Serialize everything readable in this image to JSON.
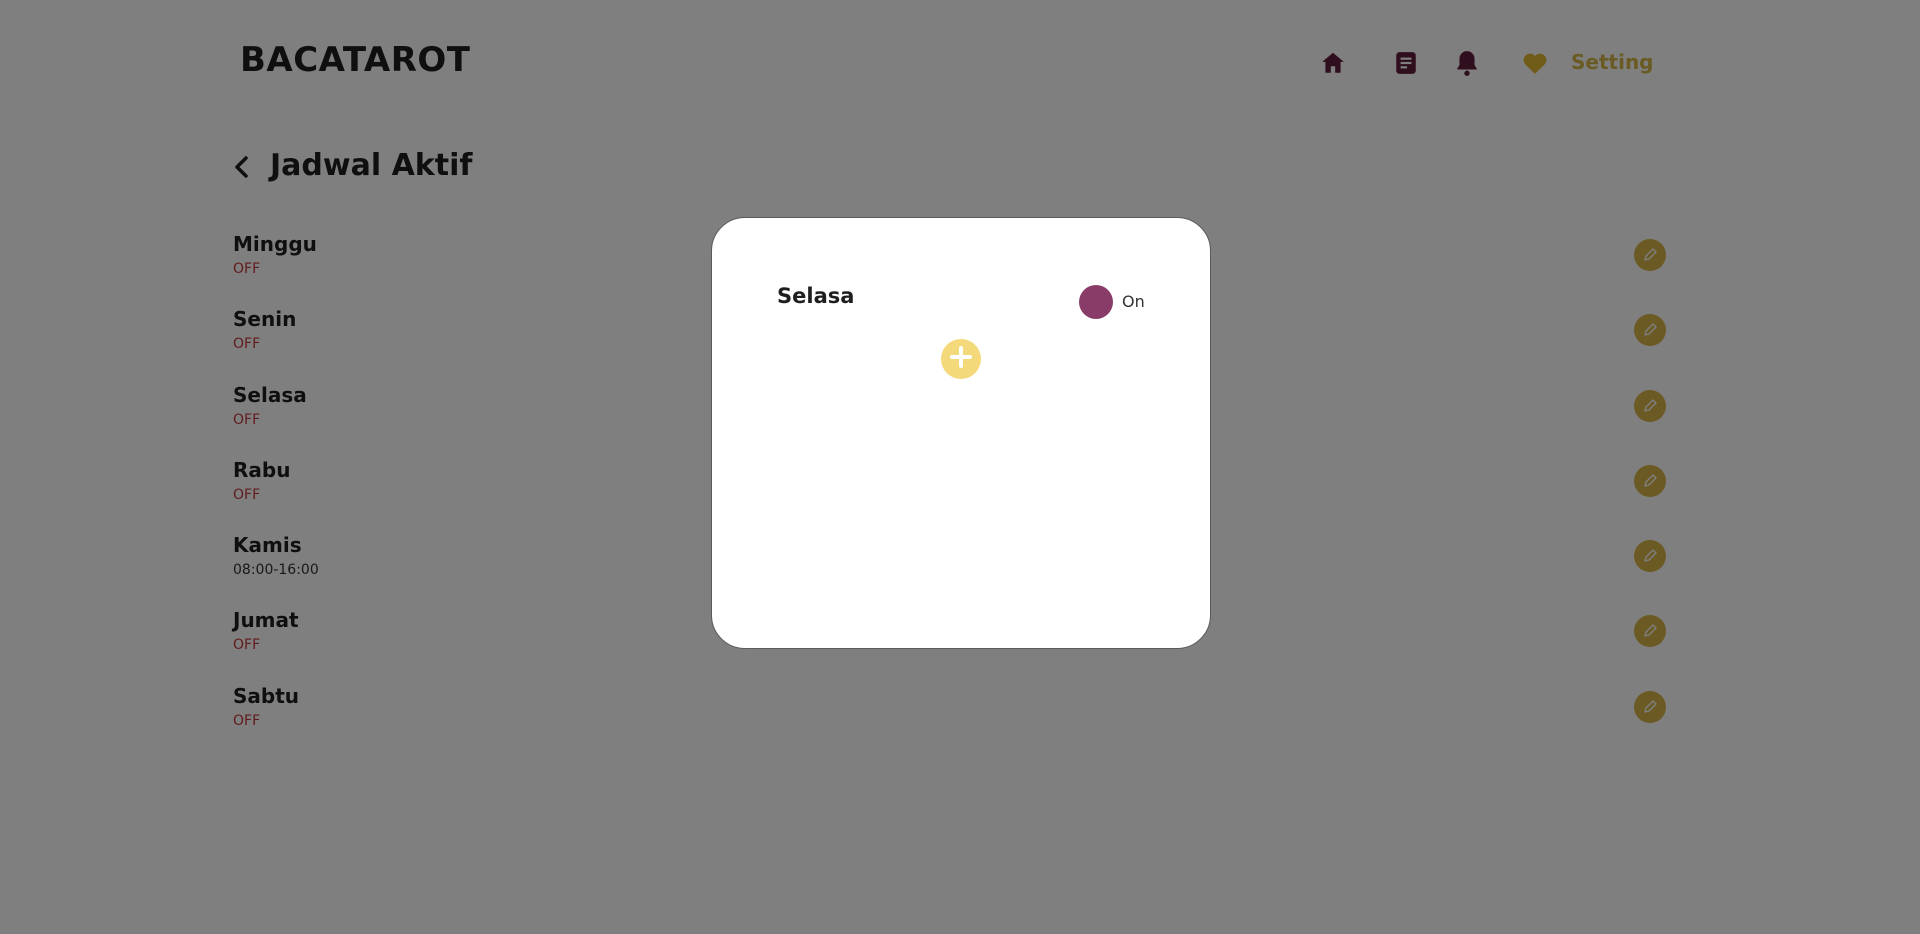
{
  "app": {
    "brand": "BACATAROT"
  },
  "nav": {
    "items": [
      {
        "icon": "home-icon"
      },
      {
        "icon": "document-icon"
      },
      {
        "icon": "bell-icon"
      },
      {
        "icon": "heart-icon"
      }
    ],
    "setting_label": "Setting"
  },
  "page": {
    "title": "Jadwal Aktif",
    "back_icon": "chevron-left-icon"
  },
  "schedule": [
    {
      "day": "Minggu",
      "status": "OFF"
    },
    {
      "day": "Senin",
      "status": "OFF"
    },
    {
      "day": "Selasa",
      "status": "OFF"
    },
    {
      "day": "Rabu",
      "status": "OFF"
    },
    {
      "day": "Kamis",
      "status": "08:00-16:00"
    },
    {
      "day": "Jumat",
      "status": "OFF"
    },
    {
      "day": "Sabtu",
      "status": "OFF"
    }
  ],
  "modal": {
    "title": "Selasa",
    "toggle_label": "On",
    "add_icon": "plus-icon"
  },
  "colors": {
    "brand_dark": "#5e1e3a",
    "accent_gold": "#d4b446",
    "off_red": "#c0393b",
    "toggle_on": "#8a3c68",
    "add_button": "#f4d97a"
  }
}
